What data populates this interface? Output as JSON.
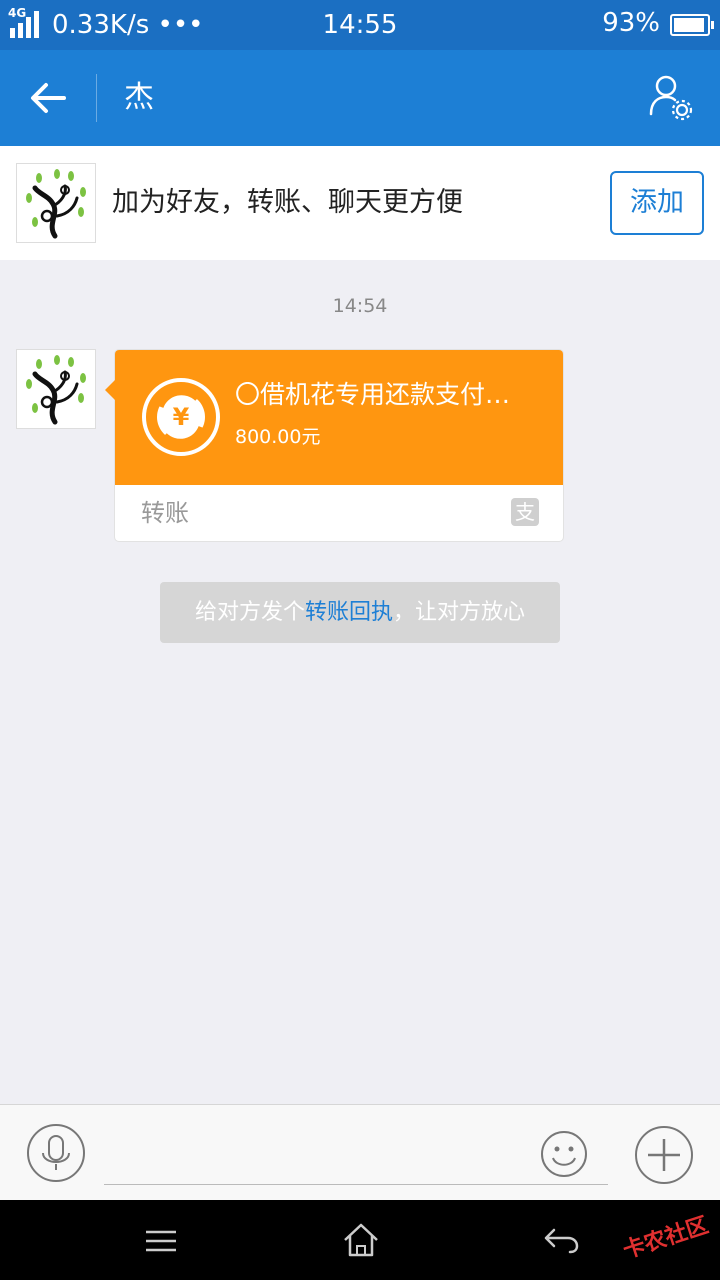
{
  "status_bar": {
    "network": "4G",
    "speed": "0.33K/s •••",
    "time": "14:55",
    "battery": "93%",
    "battery_level": 0.93
  },
  "header": {
    "title": "杰"
  },
  "add_friend": {
    "message": "加为好友，转账、聊天更方便",
    "button": "添加"
  },
  "chat": {
    "timestamp": "14:54",
    "transfer": {
      "title": "〇借机花专用还款支付…",
      "amount": "800.00元",
      "label": "转账",
      "source_icon_text": "支"
    },
    "tip": {
      "prefix": "给对方发个",
      "link": "转账回执",
      "suffix": "，让对方放心"
    }
  },
  "watermark": "卡农社区",
  "colors": {
    "accent": "#1d7fd5",
    "status_bar": "#1b6fc2",
    "transfer_card": "#ff9610",
    "background": "#efeff4"
  }
}
